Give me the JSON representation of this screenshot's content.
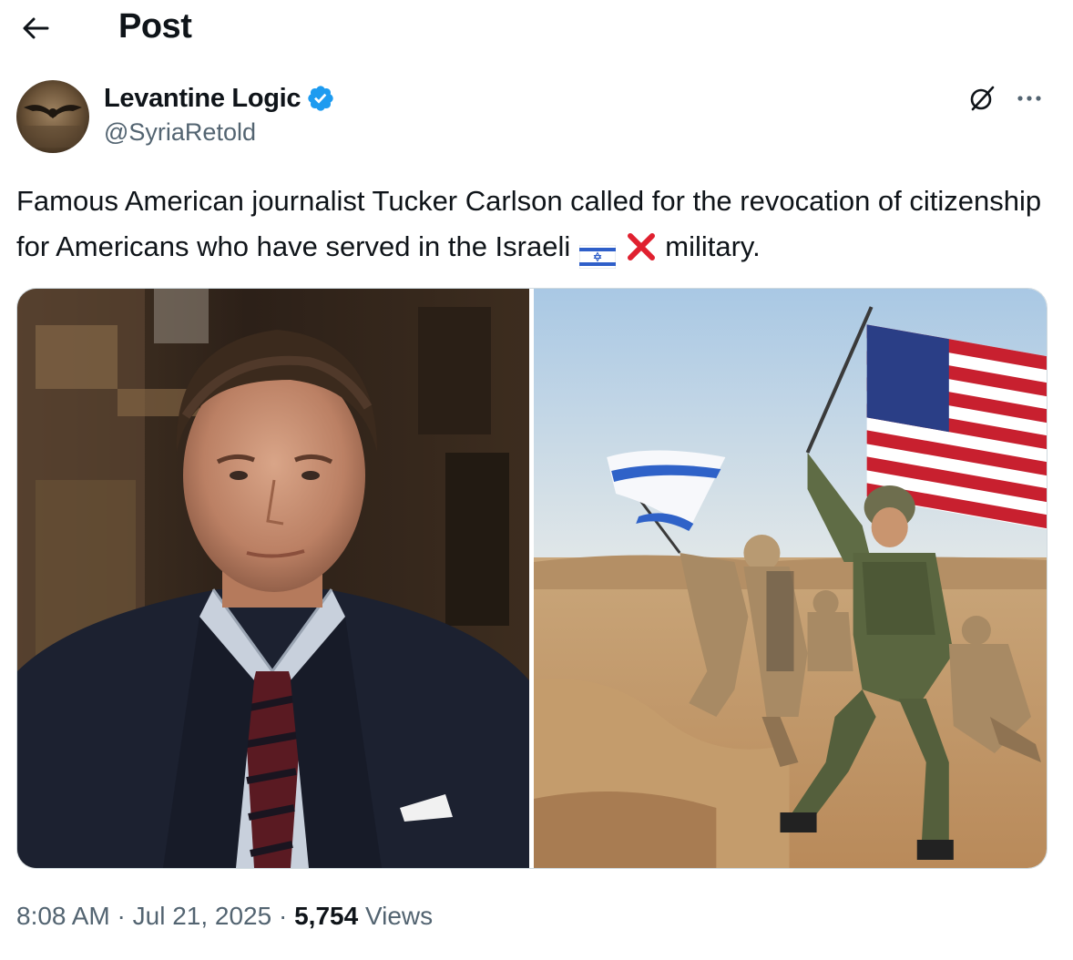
{
  "header": {
    "title": "Post"
  },
  "author": {
    "name": "Levantine Logic",
    "handle": "@SyriaRetold"
  },
  "tweet": {
    "text_main": "Famous American journalist Tucker Carlson called for the revocation of citizenship for Americans who have served in the Israeli",
    "text_end": "military."
  },
  "meta": {
    "time": "8:08 AM",
    "separator": "·",
    "date": "Jul 21, 2025",
    "views_count": "5,754",
    "views_label": "Views"
  },
  "colors": {
    "verified": "#1d9bf0",
    "text": "#0f1419",
    "secondary": "#536471",
    "border": "#cfd9de"
  },
  "icons": [
    "back-arrow-icon",
    "verified-badge-icon",
    "grok-icon",
    "more-options-icon",
    "israel-flag-emoji",
    "cross-mark-emoji"
  ]
}
